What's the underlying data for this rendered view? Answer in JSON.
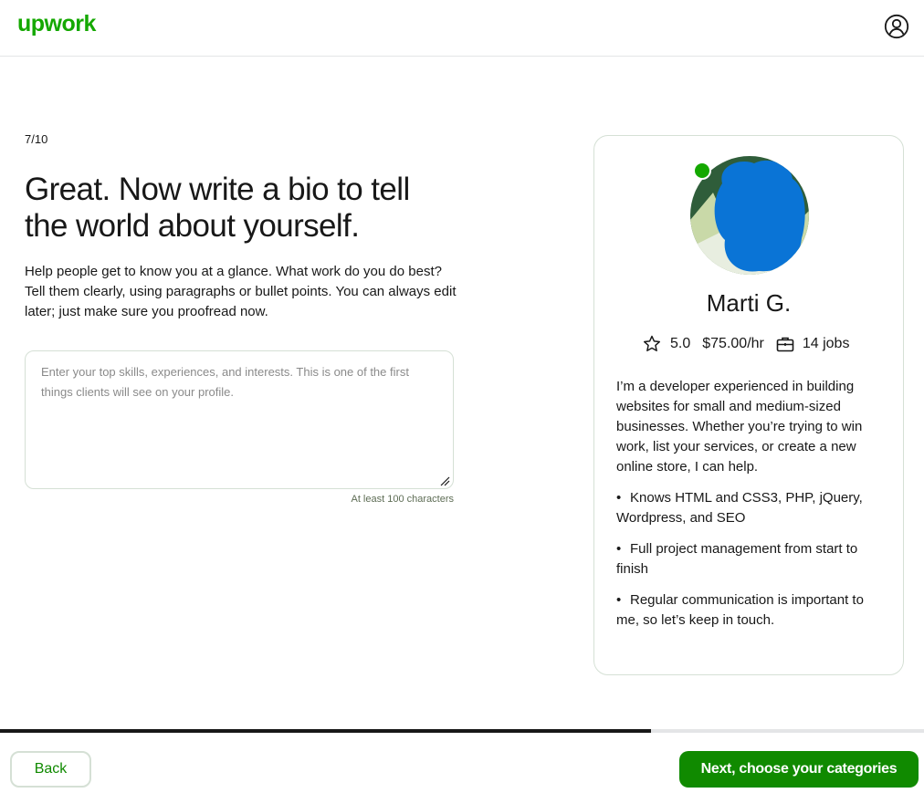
{
  "header": {
    "logo_text": "upwork",
    "user_icon": "user-circle-icon"
  },
  "main": {
    "step": "7/10",
    "title": "Great. Now write a bio to tell the world about yourself.",
    "description": "Help people get to know you at a glance. What work do you do best? Tell them clearly, using paragraphs or bullet points. You can always edit later; just make sure you proofread now.",
    "bio_field": {
      "value": "",
      "placeholder": "Enter your top skills, experiences, and interests. This is one of the first things clients will see on your profile."
    },
    "hint": "At least 100 characters"
  },
  "preview_card": {
    "name": "Marti G.",
    "rating": "5.0",
    "rate": "$75.00/hr",
    "jobs": "14 jobs",
    "online": true,
    "bio_intro": "I’m a developer experienced in building websites for small and medium-sized businesses. Whether you’re trying to win work, list your services, or create a new online store, I can help.",
    "bullets": [
      "Knows HTML and CSS3, PHP, jQuery, Wordpress, and SEO",
      "Full project management from start to finish",
      "Regular communication is important to me, so let’s keep in touch."
    ]
  },
  "progress": {
    "fraction": 0.705
  },
  "footer": {
    "back_label": "Back",
    "next_label": "Next, choose your categories"
  },
  "colors": {
    "brand": "#14a800",
    "button": "#108a00",
    "text": "#181818",
    "border": "#d5e0d5",
    "avatar_blur": "#0a74d6"
  }
}
